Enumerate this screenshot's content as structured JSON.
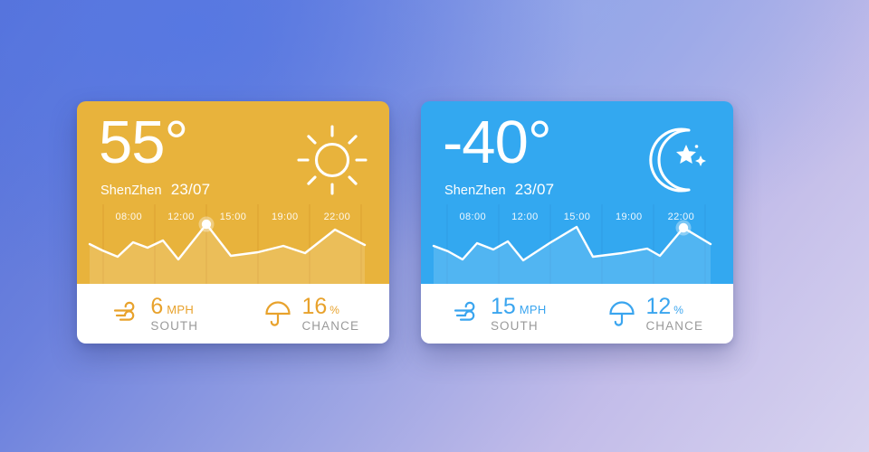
{
  "background": {
    "gradient_from": "#5570d8",
    "gradient_to": "#d8d3ef"
  },
  "cards": [
    {
      "id": "sunny-card",
      "accent_color": "#e8b33c",
      "footer_value_color": "#e8a22c",
      "temperature": "55°",
      "city": "ShenZhen",
      "date": "23/07",
      "condition_icon": "sun-icon",
      "time_labels": [
        "08:00",
        "12:00",
        "15:00",
        "19:00",
        "22:00"
      ],
      "wind": {
        "icon": "wind-icon",
        "value": "6",
        "unit": "MPH",
        "direction": "SOUTH"
      },
      "rain": {
        "icon": "umbrella-icon",
        "value": "16",
        "unit": "%",
        "label": "CHANCE"
      },
      "chart_data": {
        "type": "area",
        "title": "Hourly temperature trend",
        "categories": [
          "08:00",
          "12:00",
          "15:00",
          "19:00",
          "22:00"
        ],
        "x": [
          0,
          8,
          18,
          30,
          38,
          46,
          56,
          64,
          73,
          82,
          90,
          100
        ],
        "values": [
          46,
          28,
          33,
          62,
          52,
          66,
          30,
          88,
          34,
          40,
          56,
          34,
          78,
          44
        ],
        "highlight_index": 7,
        "highlight_label": "15:00",
        "ylim": [
          0,
          100
        ],
        "grid": true,
        "legend": "none",
        "line_color": "#ffffff",
        "fill_color": "rgba(255,255,255,0.13)"
      }
    },
    {
      "id": "night-card",
      "accent_color": "#33a8f0",
      "footer_value_color": "#3aa5ef",
      "temperature": "-40°",
      "city": "ShenZhen",
      "date": "23/07",
      "condition_icon": "moon-stars-icon",
      "time_labels": [
        "08:00",
        "12:00",
        "15:00",
        "19:00",
        "22:00"
      ],
      "wind": {
        "icon": "wind-icon",
        "value": "15",
        "unit": "MPH",
        "direction": "SOUTH"
      },
      "rain": {
        "icon": "umbrella-icon",
        "value": "12",
        "unit": "%",
        "label": "CHANCE"
      },
      "chart_data": {
        "type": "area",
        "title": "Hourly temperature trend",
        "categories": [
          "08:00",
          "12:00",
          "15:00",
          "19:00",
          "22:00"
        ],
        "x": [
          0,
          8,
          18,
          30,
          38,
          46,
          56,
          64,
          73,
          82,
          90,
          100
        ],
        "values": [
          44,
          28,
          32,
          60,
          48,
          62,
          26,
          58,
          86,
          26,
          30,
          46,
          36,
          80,
          52
        ],
        "highlight_index": 13,
        "highlight_label": "22:00",
        "ylim": [
          0,
          100
        ],
        "grid": true,
        "legend": "none",
        "line_color": "#ffffff",
        "fill_color": "rgba(255,255,255,0.13)"
      }
    }
  ]
}
